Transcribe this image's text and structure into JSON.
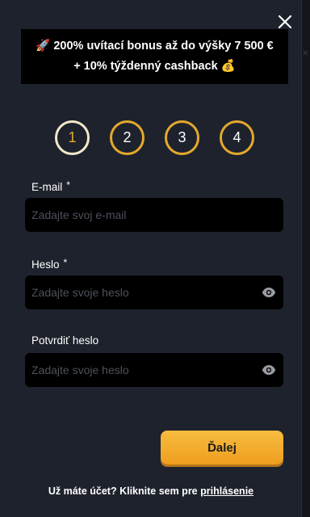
{
  "banner": {
    "rocket_emoji": "🚀",
    "line1": "200% uvítací bonus až do výšky 7 500 €",
    "line2": "+ 10% týždenný cashback",
    "money_emoji": "💰"
  },
  "steps": [
    "1",
    "2",
    "3",
    "4"
  ],
  "active_step": 1,
  "form": {
    "email": {
      "label": "E-mail",
      "required_mark": "*",
      "placeholder": "Zadajte svoj e-mail",
      "value": ""
    },
    "password": {
      "label": "Heslo",
      "required_mark": "*",
      "placeholder": "Zadajte svoje heslo",
      "value": ""
    },
    "confirm": {
      "label": "Potvrdiť heslo",
      "placeholder": "Zadajte svoje heslo",
      "value": ""
    }
  },
  "next_button": "Ďalej",
  "footer": {
    "text": "Už máte účet? Kliknite sem pre",
    "link": "prihlásenie"
  },
  "colors": {
    "accent": "#e4a92c",
    "modal_bg": "#1e222d",
    "input_bg": "#000000",
    "button": "#f2a72a"
  },
  "icons": {
    "close": "close-icon",
    "eye": "eye-icon"
  }
}
